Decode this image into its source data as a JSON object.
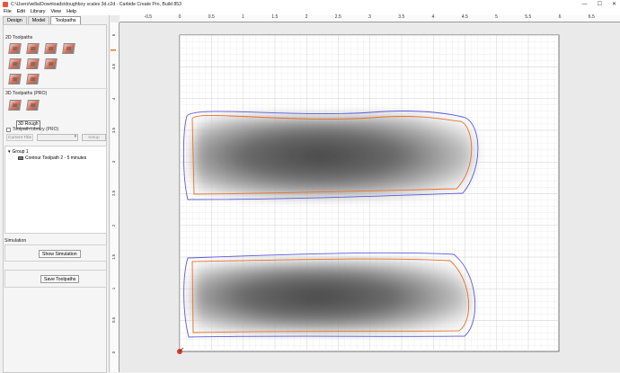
{
  "window": {
    "title": "C:\\Users\\willa\\Downloads\\doughboy scales 3d.c2d - Carbide Create Pro, Build 853",
    "minimize": "—",
    "maximize": "☐",
    "close": "✕"
  },
  "menu": [
    "File",
    "Edit",
    "Library",
    "View",
    "Help"
  ],
  "tabs": [
    "Design",
    "Model",
    "Toolpaths"
  ],
  "active_tab": "Toolpaths",
  "toolpaths_2d": {
    "label": "2D Toolpaths",
    "tools": [
      "contour-toolpath",
      "pocket-toolpath",
      "drill-toolpath",
      "vcarve-toolpath",
      "texture-toolpath",
      "adaptive-toolpath",
      "chamfer-toolpath",
      "advanced-vcarve-toolpath",
      "thread-mill-toolpath"
    ]
  },
  "toolpaths_3d": {
    "label": "3D Toolpaths (PRO)",
    "tools": [
      "3d-rough-toolpath",
      "3d-finish-toolpath"
    ],
    "tooltip": "3D Rough"
  },
  "toolpath_library": {
    "label": "Toolpath Library (PRO)"
  },
  "controls": {
    "current_title": "Current Title",
    "select_value": "",
    "setup": "Setup"
  },
  "tree": {
    "group": "Group 1",
    "item": "Contour Toolpath 2 - 5 minutes"
  },
  "simulation": {
    "label": "Simulation",
    "show_button": "Show Simulation",
    "save_button": "Save Toolpaths"
  },
  "ruler_top": [
    "-0.5",
    "0",
    "0.5",
    "1",
    "1.5",
    "2",
    "2.5",
    "3",
    "3.5",
    "4",
    "4.5",
    "5",
    "5.5",
    "6",
    "6.5"
  ],
  "ruler_left": [
    "5",
    "4.5",
    "4",
    "3.5",
    "3",
    "2.5",
    "2",
    "1.5",
    "1",
    "0.5",
    "0"
  ],
  "colors": {
    "offset_path": "#5a5adc",
    "contour_path": "#e8702a",
    "grid_minor": "#e4e4e4",
    "grid_major": "#c9c9c9",
    "origin": "#d43a2a"
  }
}
